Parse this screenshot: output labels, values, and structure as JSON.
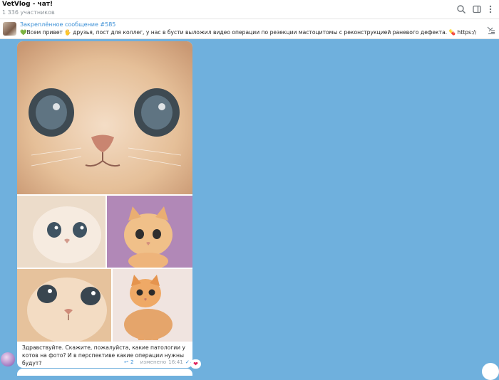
{
  "header": {
    "title": "VetVlog - чат!",
    "subtitle": "1 336 участников",
    "icons": [
      "search-icon",
      "sidebar-toggle-icon",
      "more-vertical-icon"
    ]
  },
  "pinned": {
    "title": "Закреплённое сообщение #585",
    "text": "💚Всем привет 🖐 друзья, пост для коллег, у нас в бусти выложил видео операции по резекции мастоцитомы с реконструкцией раневого дефекта. 💊 https://boosty.to/vetvet/p...",
    "icon": "pinned-list-icon"
  },
  "message": {
    "caption": "Здравствуйте. Скажите, пожалуйста, какие патологии у котов на фото? И в перспективе какие операции нужны будут?",
    "replies": "2",
    "edited": "изменено",
    "time": "16:41",
    "reaction": "❤"
  },
  "colors": {
    "chat_background": "#6fb0dd",
    "accent": "#3a8fd6"
  }
}
